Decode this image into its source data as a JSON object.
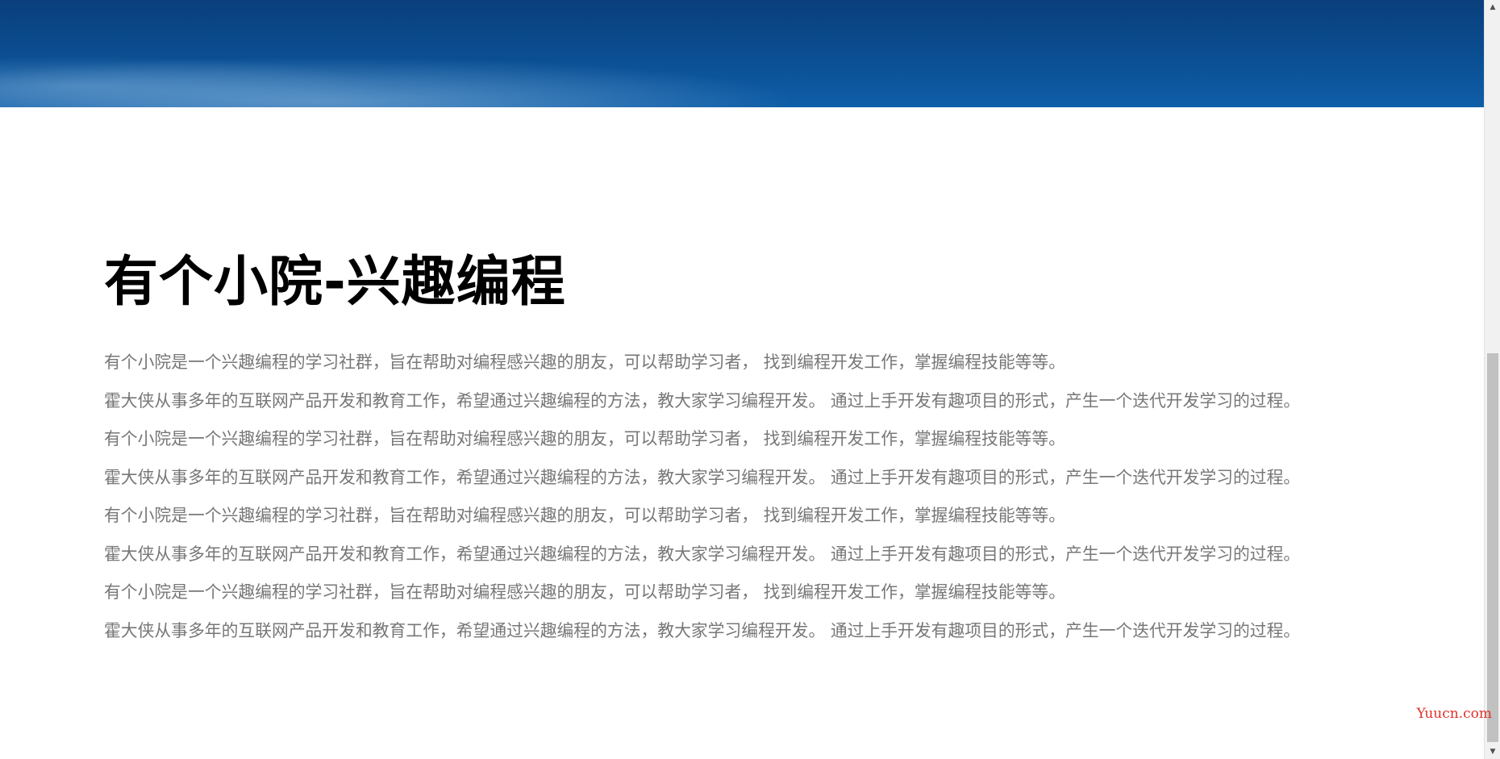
{
  "hero": {
    "background_color": "#0b4f93"
  },
  "main": {
    "title": "有个小院-兴趣编程",
    "paragraphs": [
      "有个小院是一个兴趣编程的学习社群，旨在帮助对编程感兴趣的朋友，可以帮助学习者， 找到编程开发工作，掌握编程技能等等。",
      "霍大侠从事多年的互联网产品开发和教育工作，希望通过兴趣编程的方法，教大家学习编程开发。 通过上手开发有趣项目的形式，产生一个迭代开发学习的过程。",
      "有个小院是一个兴趣编程的学习社群，旨在帮助对编程感兴趣的朋友，可以帮助学习者， 找到编程开发工作，掌握编程技能等等。",
      "霍大侠从事多年的互联网产品开发和教育工作，希望通过兴趣编程的方法，教大家学习编程开发。 通过上手开发有趣项目的形式，产生一个迭代开发学习的过程。",
      "有个小院是一个兴趣编程的学习社群，旨在帮助对编程感兴趣的朋友，可以帮助学习者， 找到编程开发工作，掌握编程技能等等。",
      "霍大侠从事多年的互联网产品开发和教育工作，希望通过兴趣编程的方法，教大家学习编程开发。 通过上手开发有趣项目的形式，产生一个迭代开发学习的过程。",
      "有个小院是一个兴趣编程的学习社群，旨在帮助对编程感兴趣的朋友，可以帮助学习者， 找到编程开发工作，掌握编程技能等等。",
      "霍大侠从事多年的互联网产品开发和教育工作，希望通过兴趣编程的方法，教大家学习编程开发。 通过上手开发有趣项目的形式，产生一个迭代开发学习的过程。"
    ]
  },
  "scrollbar": {
    "up_icon": "arrow-up-icon",
    "down_icon": "arrow-down-icon",
    "up_glyph": "▲",
    "down_glyph": "▼"
  },
  "watermark": {
    "text": "Yuucn.com",
    "color": "#e0302a"
  },
  "colors": {
    "title": "#000000",
    "body_text": "#777777"
  }
}
